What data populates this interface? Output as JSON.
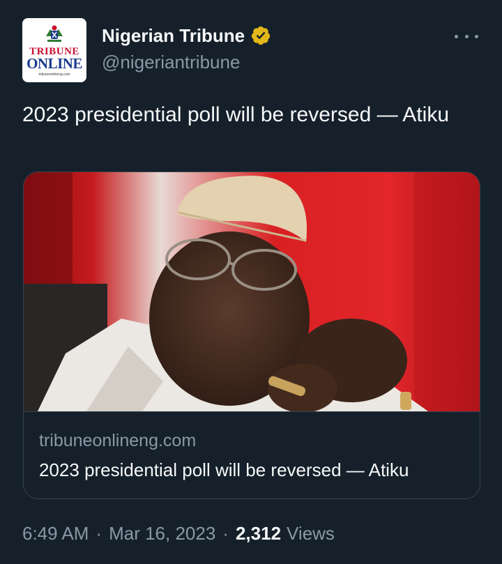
{
  "author": {
    "display_name": "Nigerian Tribune",
    "handle": "@nigeriantribune",
    "verified_icon": "verified-badge-gold",
    "avatar": {
      "line1": "TRIBUNE",
      "line2": "ONLINE",
      "line3": "tribuneonlineng.com"
    }
  },
  "tweet": {
    "text": "2023 presidential poll will be reversed — Atiku"
  },
  "card": {
    "domain": "tribuneonlineng.com",
    "title": "2023 presidential poll will be reversed — Atiku",
    "image_icon": "photo-man-in-cap"
  },
  "meta": {
    "time": "6:49 AM",
    "separator": "·",
    "date": "Mar 16, 2023",
    "views_count": "2,312",
    "views_label": "Views"
  },
  "colors": {
    "background": "#15202b",
    "text": "#f7f9f9",
    "secondary": "#8b98a5",
    "border": "#38444d",
    "verified": "#e2b719"
  }
}
